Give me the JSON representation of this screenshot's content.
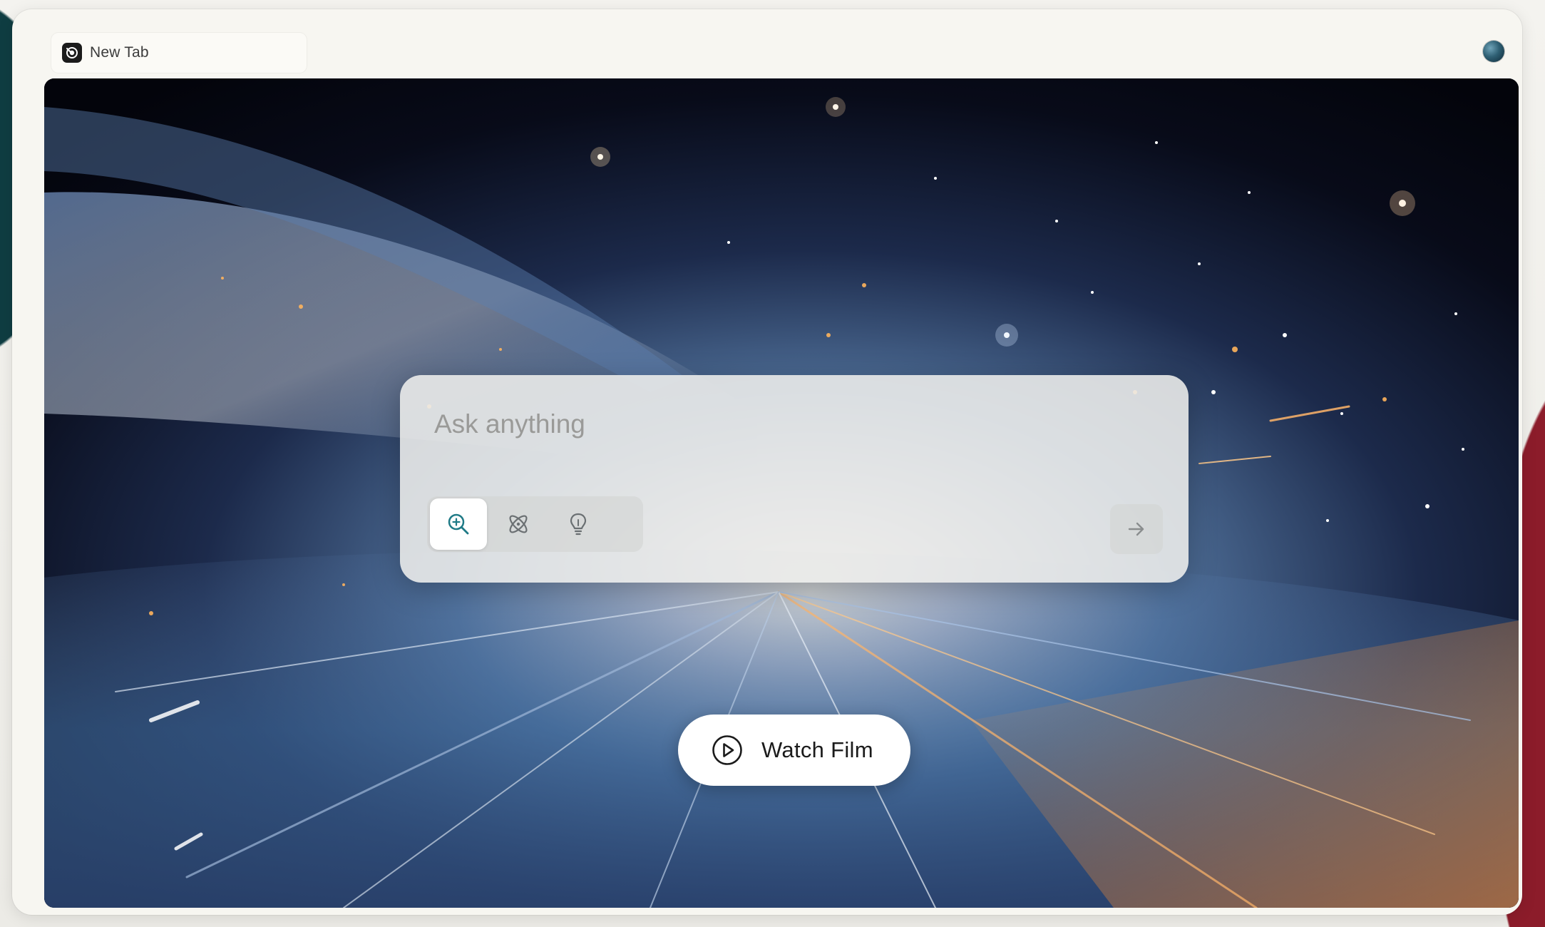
{
  "tab": {
    "title": "New Tab",
    "favicon": "perplexity-comet-icon"
  },
  "profile": {
    "icon": "profile-avatar-icon"
  },
  "search": {
    "placeholder": "Ask anything",
    "value": "",
    "modes": [
      {
        "name": "search",
        "icon": "search-zoom-icon",
        "active": true
      },
      {
        "name": "research",
        "icon": "atom-icon",
        "active": false
      },
      {
        "name": "labs",
        "icon": "lightbulb-icon",
        "active": false
      }
    ],
    "submit_icon": "arrow-right-icon"
  },
  "film_button": {
    "label": "Watch Film",
    "icon": "play-circle-icon"
  },
  "colors": {
    "accent": "#1f7a86",
    "background_dark": "#05060f",
    "card": "#eeeeec"
  }
}
